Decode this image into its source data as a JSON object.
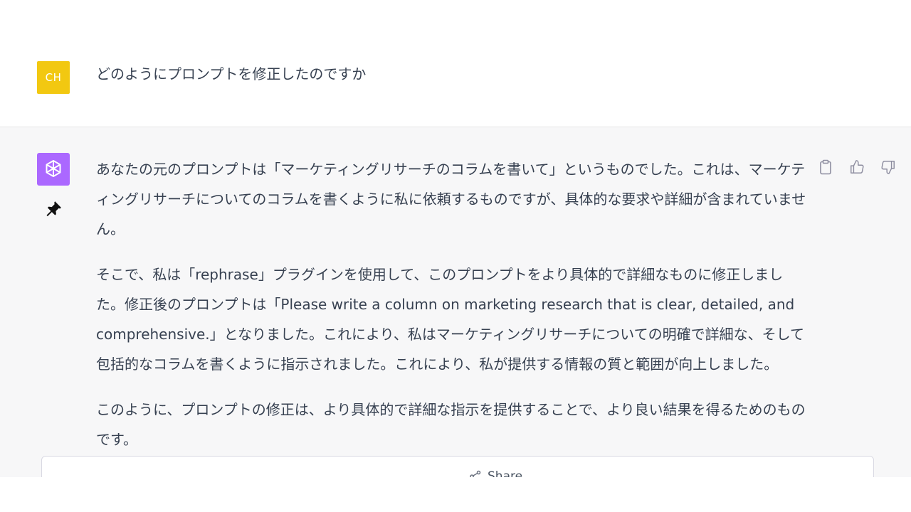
{
  "user_message": {
    "avatar_initials": "CH",
    "avatar_color": "#f2c811",
    "text": "どのようにプロンプトを修正したのですか"
  },
  "assistant_message": {
    "avatar_icon": "openai-logo-icon",
    "avatar_color": "#ab68ff",
    "paragraphs": [
      "あなたの元のプロンプトは「マーケティングリサーチのコラムを書いて」というものでした。これは、マーケティングリサーチについてのコラムを書くように私に依頼するものですが、具体的な要求や詳細が含まれていません。",
      "そこで、私は「rephrase」プラグインを使用して、このプロンプトをより具体的で詳細なものに修正しました。修正後のプロンプトは「Please write a column on marketing research that is clear, detailed, and comprehensive.」となりました。これにより、私はマーケティングリサーチについての明確で詳細な、そして包括的なコラムを書くように指示されました。これにより、私が提供する情報の質と範囲が向上しました。",
      "このように、プロンプトの修正は、より具体的で詳細な指示を提供することで、より良い結果を得るためのものです。"
    ]
  },
  "actions": {
    "copy_icon": "clipboard-icon",
    "like_icon": "thumbs-up-icon",
    "dislike_icon": "thumbs-down-icon"
  },
  "share": {
    "label": "Share",
    "icon": "share-icon"
  }
}
